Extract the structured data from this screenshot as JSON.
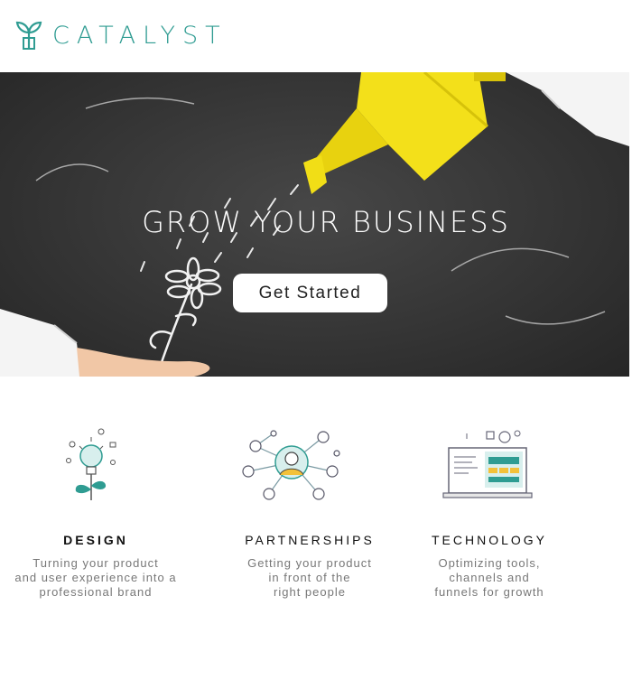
{
  "brand": {
    "name": "CATALYST",
    "accent": "#2f9c92",
    "logo_icon": "plant-sprout-icon"
  },
  "hero": {
    "title": "GROW YOUR BUSINESS",
    "cta_label": "Get Started",
    "background": "chalkboard with yellow watering can and chalk flower"
  },
  "features": [
    {
      "icon": "lightbulb-design-icon",
      "title": "DESIGN",
      "description": "Turning your product\nand user experience into a\nprofessional brand"
    },
    {
      "icon": "partnerships-network-icon",
      "title": "PARTNERSHIPS",
      "description": "Getting your product\nin front of the\nright people"
    },
    {
      "icon": "technology-laptop-icon",
      "title": "TECHNOLOGY",
      "description": "Optimizing tools,\nchannels and\nfunnels for growth"
    }
  ]
}
